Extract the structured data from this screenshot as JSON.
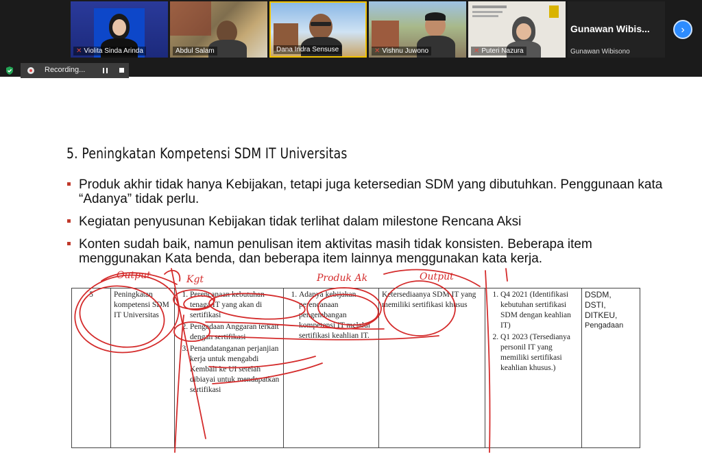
{
  "participants": [
    {
      "name": "Violita Sinda Arinda",
      "muted": true
    },
    {
      "name": "Abdul Salam",
      "muted": false
    },
    {
      "name": "Dana  Indra Sensuse",
      "muted": false
    },
    {
      "name": "Vishnu Juwono",
      "muted": true
    },
    {
      "name": "Puteri Nazura",
      "muted": true
    }
  ],
  "active_speaker": {
    "display": "Gunawan  Wibis...",
    "name": "Gunawan Wibisono"
  },
  "recording": {
    "label": "Recording..."
  },
  "slide": {
    "title": "5. Peningkatan Kompetensi SDM IT Universitas",
    "bullets": [
      "Produk akhir tidak hanya Kebijakan, tetapi juga ketersedian SDM yang dibutuhkan. Penggunaan kata “Adanya” tidak perlu.",
      "Kegiatan penyusunan Kebijakan tidak terlihat dalam milestone Rencana Aksi",
      "Konten sudah baik, namun penulisan item aktivitas masih tidak konsisten. Beberapa item menggunakan Kata benda, dan beberapa item lainnya menggunakan kata kerja."
    ],
    "table": {
      "no": "5",
      "program": "Peningkatan kompetensi SDM IT Universitas",
      "activities": [
        "Perencanaan kebutuhan tenaga IT yang akan di sertifikasi",
        "Pengadaan Anggaran terkait dengan sertifikasi",
        "Penandatanganan perjanjian kerja untuk mengabdi Kembali ke UI setelah dibiayai untuk mendapatkan sertifikasi"
      ],
      "outputs": [
        "Adanya kebijakan perencanaan pengembangan kompetensi IT melalui sertifikasi keahlian IT."
      ],
      "indicator": "Ketersediaanya SDM IT yang memiliki sertifikasi khusus",
      "timeline": [
        "Q4 2021 (Identifikasi kebutuhan sertifikasi SDM dengan keahlian IT)",
        "Q1 2023 (Tersedianya personil IT yang memiliki sertifikasi keahlian khusus.)"
      ],
      "pic": [
        "DSDM,",
        "DSTI,",
        "DITKEU,",
        "Pengadaan"
      ]
    },
    "annotations": [
      "Output",
      "Kgt",
      "Produk Ak",
      "Output"
    ]
  },
  "colors": {
    "ink": "#d42b2b",
    "bullet": "#c0392b",
    "zoom_blue": "#2d8cff"
  }
}
